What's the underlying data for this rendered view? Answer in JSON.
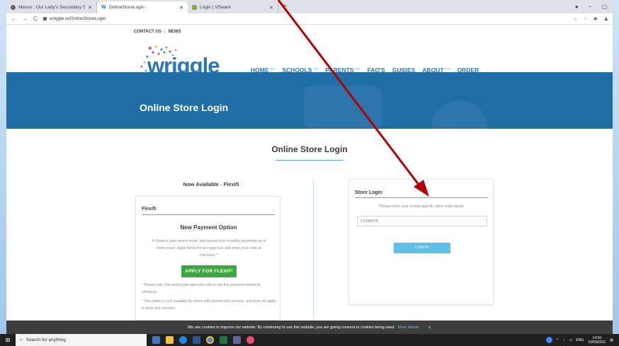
{
  "browser": {
    "tabs": [
      {
        "title": "Menus : Our Lady's Secondary S",
        "active": false
      },
      {
        "title": "OnlineStoreLogin",
        "active": true
      },
      {
        "title": "Login | VSware",
        "active": false
      }
    ],
    "url": "wriggle.ie/OnlineStoreLogin",
    "new_tab": "+"
  },
  "site": {
    "top_links": [
      "CONTACT US",
      "NEWS"
    ],
    "logo_text": "wriggle",
    "nav": [
      {
        "label": "HOME",
        "dropdown": true
      },
      {
        "label": "SCHOOLS",
        "dropdown": true
      },
      {
        "label": "PARENTS",
        "dropdown": true
      },
      {
        "label": "FAQ'S",
        "dropdown": false
      },
      {
        "label": "GUIDES",
        "dropdown": false
      },
      {
        "label": "ABOUT",
        "dropdown": true
      },
      {
        "label": "ORDER",
        "dropdown": false
      }
    ],
    "banner_title": "Online Store Login",
    "section_title": "Online Store Login",
    "brand_color": "#2a76b8",
    "banner_color": "#1f6ea8",
    "accent_color": "#4aa9d8"
  },
  "flexifi": {
    "heading": "Now Available - Flexifi",
    "card_title": "Flexifi",
    "subtitle": "New Payment Option",
    "description": "To finance your device order, and spread your monthly payments up to three years, apply below for pre-approval and enter your code at checkout. *",
    "apply_label": "APPLY FOR FLEXIFI",
    "note1": "* Please note: You need a pre-approval code to use this payment method at checkout.",
    "note2": "* This option is only available for stores with devices and services, and does not apply to book only services."
  },
  "store_login": {
    "title": "Store Login",
    "description": "Please enter your school specific store code below.",
    "placeholder": "12345678",
    "login_label": "LOGIN"
  },
  "cookie_bar": {
    "text": "We use cookies to improve our website. By continuing to use this website, you are giving consent to cookies being used.",
    "more": "More details",
    "close": "✕"
  },
  "taskbar": {
    "search_placeholder": "Search for anything",
    "lang": "ENG",
    "time": "14:59",
    "date": "16/09/2021"
  }
}
